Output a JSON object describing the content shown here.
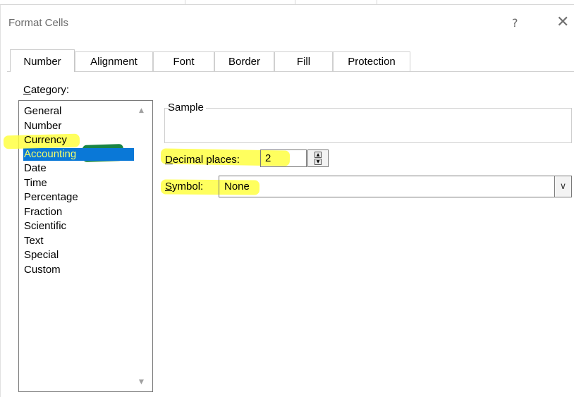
{
  "dialog": {
    "title": "Format Cells",
    "help_label": "?",
    "close_label": "✕"
  },
  "tabs": [
    {
      "label": "Number",
      "active": true
    },
    {
      "label": "Alignment",
      "active": false
    },
    {
      "label": "Font",
      "active": false
    },
    {
      "label": "Border",
      "active": false
    },
    {
      "label": "Fill",
      "active": false
    },
    {
      "label": "Protection",
      "active": false
    }
  ],
  "category": {
    "label": "Category:",
    "items": [
      "General",
      "Number",
      "Currency",
      "Accounting",
      "Date",
      "Time",
      "Percentage",
      "Fraction",
      "Scientific",
      "Text",
      "Special",
      "Custom"
    ],
    "selected": "Accounting"
  },
  "sample": {
    "label": "Sample",
    "value": ""
  },
  "decimal_places": {
    "label": "Decimal places:",
    "value": "2"
  },
  "symbol": {
    "label": "Symbol:",
    "value": "None"
  },
  "colors": {
    "selection": "#0a78d7",
    "highlighter_yellow": "#ffff3a",
    "highlighter_green": "#0d7d3a"
  },
  "icons": {
    "scroll_up": "chevron-up-icon",
    "scroll_down": "chevron-down-icon",
    "spin_up": "triangle-up-icon",
    "spin_down": "triangle-down-icon",
    "dropdown": "chevron-down-icon"
  }
}
